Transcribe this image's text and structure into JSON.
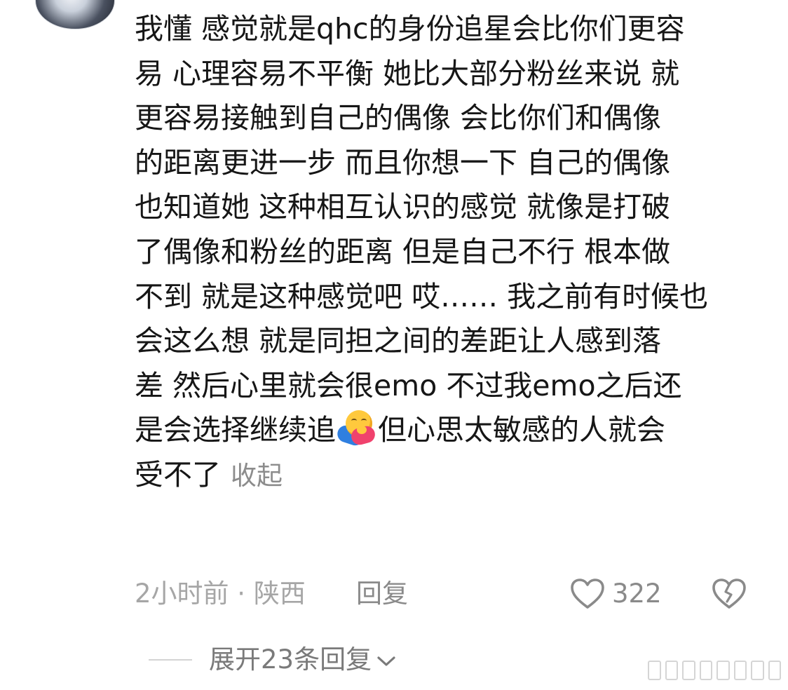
{
  "comment": {
    "lines": [
      "我懂 感觉就是qhc的身份追星会比你们更容",
      "易 心理容易不平衡 她比大部分粉丝来说 就",
      "更容易接触到自己的偶像 会比你们和偶像",
      "的距离更进一步 而且你想一下 自己的偶像",
      "也知道她 这种相互认识的感觉 就像是打破",
      "了偶像和粉丝的距离 但是自己不行 根本做",
      "不到 就是这种感觉吧 哎…… 我之前有时候也",
      "会这么想 就是同担之间的差距让人感到落",
      "差 然后心里就会很emo 不过我emo之后还"
    ],
    "line10_before_emoji": "是会选择继续追",
    "emoji": "hugging-face-emoji",
    "line10_after_emoji": "但心思太敏感的人就会",
    "last_line": "受不了",
    "collapse_label": "收起"
  },
  "meta": {
    "time": "2小时前",
    "separator": " · ",
    "location": "陕西",
    "reply_label": "回复",
    "like_count": "322",
    "like_icon": "heart-outline-icon",
    "dislike_icon": "broken-heart-icon"
  },
  "replies": {
    "expand_label": "展开23条回复"
  },
  "colors": {
    "text": "#161616",
    "meta": "#a6a6a6",
    "action": "#8a8a8a",
    "collapse": "#8c8c8c"
  }
}
